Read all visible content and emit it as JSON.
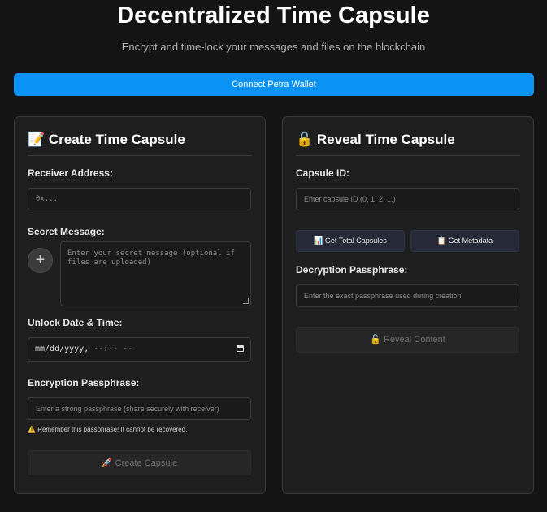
{
  "header": {
    "title": "Decentralized Time Capsule",
    "subtitle": "Encrypt and time-lock your messages and files on the blockchain",
    "connect_label": "Connect Petra Wallet",
    "accent_color": "#0a93f5"
  },
  "create": {
    "icon": "📝",
    "title": "Create Time Capsule",
    "receiver_label": "Receiver Address:",
    "receiver_placeholder": "0x...",
    "message_label": "Secret Message:",
    "message_placeholder": "Enter your secret message (optional if files are uploaded)",
    "attach_icon": "+",
    "unlock_label": "Unlock Date & Time:",
    "unlock_value": "mm/dd/yyyy, --:-- --",
    "passphrase_label": "Encryption Passphrase:",
    "passphrase_placeholder": "Enter a strong passphrase (share securely with receiver)",
    "warning_icon": "⚠️",
    "warning_text": "Remember this passphrase! It cannot be recovered.",
    "submit_icon": "🚀",
    "submit_label": "Create Capsule"
  },
  "reveal": {
    "icon": "🔓",
    "title": "Reveal Time Capsule",
    "capsule_id_label": "Capsule ID:",
    "capsule_id_placeholder": "Enter capsule ID (0, 1, 2, ...)",
    "total_icon": "📊",
    "total_label": "Get Total Capsules",
    "metadata_icon": "📋",
    "metadata_label": "Get Metadata",
    "passphrase_label": "Decryption Passphrase:",
    "passphrase_placeholder": "Enter the exact passphrase used during creation",
    "submit_icon": "🔓",
    "submit_label": "Reveal Content"
  }
}
